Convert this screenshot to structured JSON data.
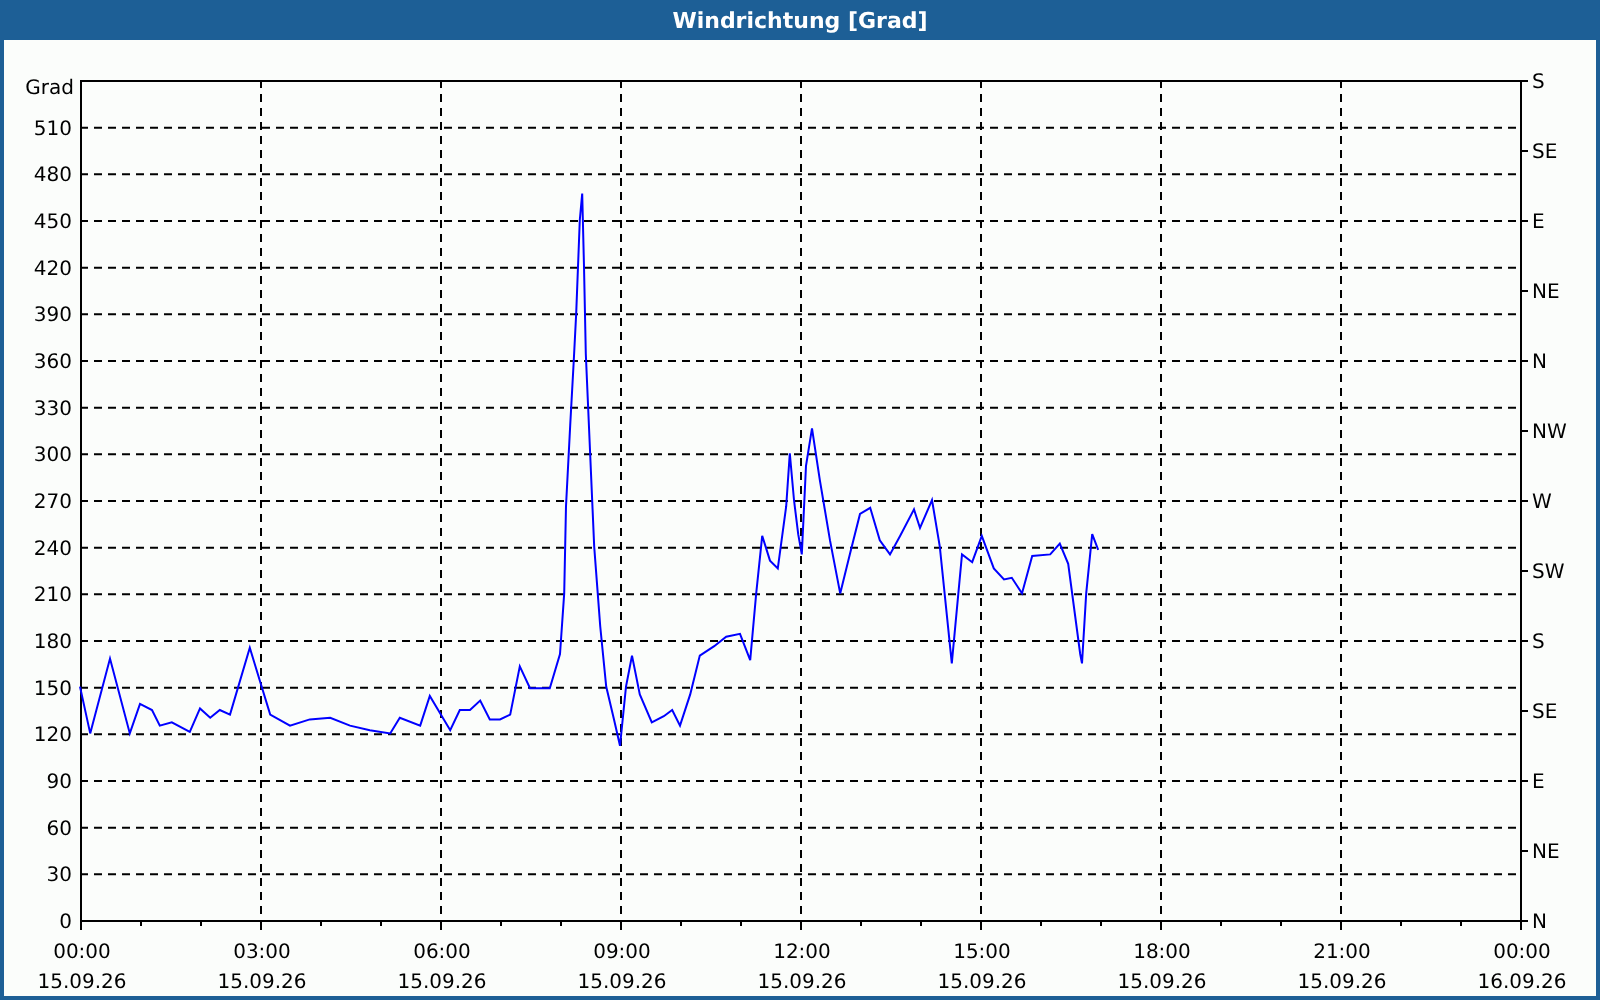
{
  "window": {
    "title": "Windrichtung [Grad]"
  },
  "chart": {
    "date_labels": [
      "15.09.26",
      "15.09.26",
      "15.09.26",
      "15.09.26",
      "15.09.26",
      "15.09.26",
      "15.09.26",
      "15.09.26",
      "16.09.26"
    ],
    "compass_labels": [
      "S",
      "SE",
      "E",
      "NE",
      "N",
      "NW",
      "W",
      "SW",
      "S",
      "SE",
      "E",
      "NE",
      "N"
    ],
    "chart_data": {
      "type": "line",
      "grid": true,
      "ylabel": "Grad",
      "xlim": [
        0,
        24
      ],
      "ylim": [
        0,
        540
      ],
      "yticks": [
        0,
        30,
        60,
        90,
        120,
        150,
        180,
        210,
        240,
        270,
        300,
        330,
        360,
        390,
        420,
        450,
        480,
        510
      ],
      "xticks": [
        {
          "value": 0,
          "label": "00:00"
        },
        {
          "value": 3,
          "label": "03:00"
        },
        {
          "value": 6,
          "label": "06:00"
        },
        {
          "value": 9,
          "label": "09:00"
        },
        {
          "value": 12,
          "label": "12:00"
        },
        {
          "value": 15,
          "label": "15:00"
        },
        {
          "value": 18,
          "label": "18:00"
        },
        {
          "value": 21,
          "label": "21:00"
        },
        {
          "value": 24,
          "label": "00:00"
        }
      ],
      "x": [
        0,
        0.17,
        0.5,
        0.83,
        1,
        1.2,
        1.33,
        1.53,
        1.83,
        2,
        2.17,
        2.33,
        2.5,
        2.83,
        3.17,
        3.5,
        3.83,
        4.17,
        4.5,
        4.83,
        5.17,
        5.33,
        5.67,
        5.83,
        6.17,
        6.33,
        6.5,
        6.67,
        6.83,
        7,
        7.17,
        7.33,
        7.5,
        7.67,
        7.83,
        8,
        8.07,
        8.1,
        8.17,
        8.23,
        8.27,
        8.33,
        8.37,
        8.4,
        8.43,
        8.57,
        8.67,
        8.77,
        8.9,
        9,
        9.1,
        9.2,
        9.33,
        9.53,
        9.73,
        9.87,
        10,
        10.17,
        10.33,
        10.57,
        10.77,
        11,
        11.17,
        11.27,
        11.37,
        11.5,
        11.63,
        11.77,
        11.83,
        11.9,
        11.97,
        12.03,
        12.1,
        12.2,
        12.33,
        12.5,
        12.67,
        12.83,
        13,
        13.17,
        13.33,
        13.5,
        13.67,
        13.9,
        14,
        14.2,
        14.33,
        14.53,
        14.7,
        14.87,
        15.03,
        15.23,
        15.4,
        15.53,
        15.7,
        15.87,
        16.17,
        16.33,
        16.47,
        16.67,
        16.7,
        16.77,
        16.87,
        16.97
      ],
      "series": [
        {
          "color": "#0000ff",
          "values": [
            150,
            120,
            168,
            120,
            139,
            135,
            125,
            127,
            121,
            136,
            130,
            135,
            132,
            175,
            132,
            125,
            129,
            130,
            125,
            122,
            120,
            130,
            125,
            144,
            122,
            135,
            135,
            141,
            129,
            129,
            132,
            163,
            149,
            149,
            149,
            171,
            210,
            266,
            318,
            360,
            390,
            450,
            467,
            420,
            364,
            240,
            189,
            150,
            129,
            112,
            150,
            170,
            145,
            127,
            131,
            135,
            125,
            145,
            170,
            176,
            182,
            184,
            167,
            210,
            247,
            231,
            226,
            266,
            300,
            270,
            248,
            235,
            292,
            316,
            283,
            244,
            210,
            235,
            261,
            265,
            244,
            235,
            247,
            264,
            252,
            270,
            240,
            165,
            235,
            230,
            247,
            226,
            219,
            220,
            210,
            234,
            235,
            242,
            229,
            171,
            165,
            210,
            248,
            238
          ]
        }
      ]
    }
  }
}
